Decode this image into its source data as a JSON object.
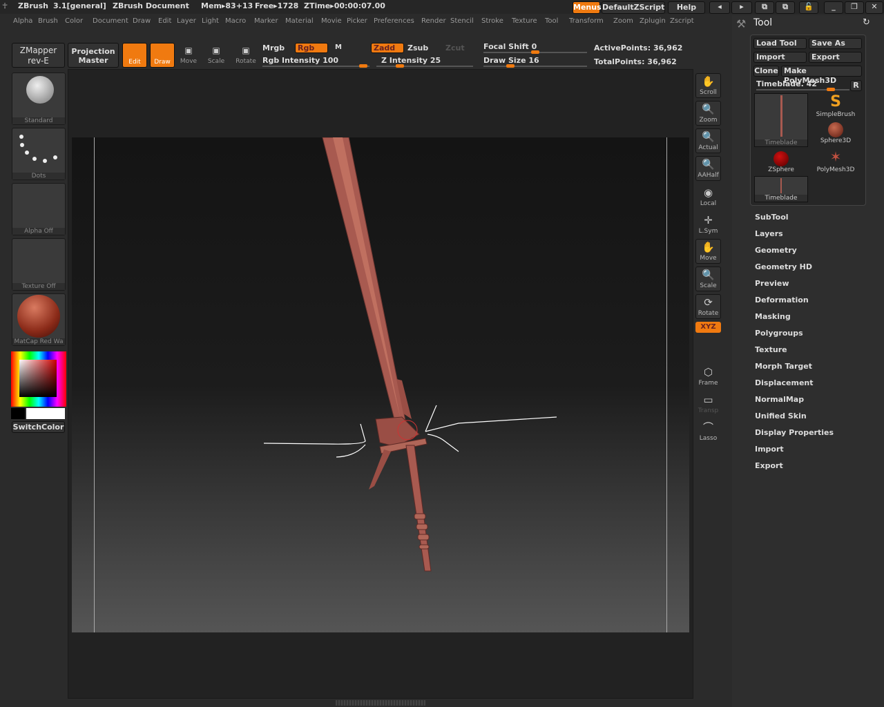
{
  "titlebar": {
    "app": "ZBrush",
    "version": "3.1[general]",
    "document": "ZBrush Document",
    "mem": "Mem▸83+13",
    "free": "Free▸1728",
    "ztime": "ZTime▸00:00:07.00",
    "menus": "Menus",
    "script": "DefaultZScript",
    "help": "Help"
  },
  "menu": [
    "Alpha",
    "Brush",
    "Color",
    "Document",
    "Draw",
    "Edit",
    "Layer",
    "Light",
    "Macro",
    "Marker",
    "Material",
    "Movie",
    "Picker",
    "Preferences",
    "Render",
    "Stencil",
    "Stroke",
    "Texture",
    "Tool",
    "Transform",
    "Zoom",
    "Zplugin",
    "Zscript"
  ],
  "toolbar": {
    "zmapper": "ZMapper",
    "zmapper_sub": "rev-E",
    "projection": "Projection",
    "projection_sub": "Master",
    "edit": "Edit",
    "draw": "Draw",
    "move": "Move",
    "scale": "Scale",
    "rotate": "Rotate",
    "mrgb": "Mrgb",
    "rgb": "Rgb",
    "m": "M",
    "rgb_intensity": "Rgb Intensity 100",
    "zadd": "Zadd",
    "zsub": "Zsub",
    "zcut": "Zcut",
    "z_intensity": "Z Intensity 25",
    "focal_shift": "Focal Shift 0",
    "draw_size": "Draw Size 16",
    "active_points": "ActivePoints: 36,962",
    "total_points": "TotalPoints: 36,962"
  },
  "sliders": {
    "rgb_intensity": 100,
    "z_intensity": 25,
    "focal_shift": 0,
    "draw_size": 16
  },
  "shelf": {
    "brush": "Standard",
    "stroke": "Dots",
    "alpha": "Alpha Off",
    "texture": "Texture Off",
    "material": "MatCap Red Wa",
    "switch_color": "SwitchColor"
  },
  "right_shelf": [
    "Scroll",
    "Zoom",
    "Actual",
    "AAHalf",
    "Local",
    "L.Sym",
    "Move",
    "Scale",
    "Rotate",
    "XYZ",
    "Frame",
    "Transp",
    "Lasso"
  ],
  "tool_panel": {
    "title": "Tool",
    "load": "Load Tool",
    "save": "Save As",
    "import": "Import",
    "export": "Export",
    "clone": "Clone",
    "make": "Make PolyMesh3D",
    "current": "Timeblade. 42",
    "r": "R",
    "tools": [
      "Timeblade",
      "SimpleBrush",
      "Sphere3D",
      "ZSphere",
      "PolyMesh3D",
      "Timeblade"
    ],
    "sections": [
      "SubTool",
      "Layers",
      "Geometry",
      "Geometry HD",
      "Preview",
      "Deformation",
      "Masking",
      "Polygroups",
      "Texture",
      "Morph Target",
      "Displacement",
      "NormalMap",
      "Unified Skin",
      "Display Properties",
      "Import",
      "Export"
    ]
  },
  "colors": {
    "accent": "#f07a10",
    "model": "#a85a50"
  }
}
